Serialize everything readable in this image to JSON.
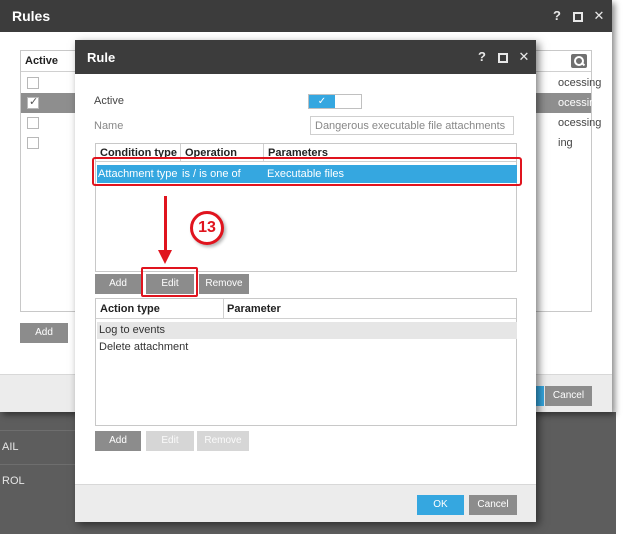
{
  "background": {
    "rows": [
      "AIL",
      "ROL"
    ]
  },
  "outer_window": {
    "title": "Rules",
    "titlebar_icons": {
      "help": "?",
      "maximize": "□",
      "close": "✕"
    },
    "grid": {
      "header_active": "Active",
      "rows": [
        {
          "checked": false,
          "selected": false,
          "text": "ocessing"
        },
        {
          "checked": true,
          "selected": true,
          "text": "ocessing"
        },
        {
          "checked": false,
          "selected": false,
          "text": "ocessing"
        },
        {
          "checked": false,
          "selected": false,
          "text": "ing"
        }
      ]
    },
    "add_label": "Add",
    "cancel_label": "Cancel"
  },
  "rule_dialog": {
    "title": "Rule",
    "titlebar_icons": {
      "help": "?",
      "maximize": "□",
      "close": "✕"
    },
    "active_label": "Active",
    "active_on": true,
    "toggle_check": "✓",
    "name_label": "Name",
    "name_value": "Dangerous executable file attachments",
    "conditions": {
      "headers": [
        "Condition type",
        "Operation",
        "Parameters"
      ],
      "rows": [
        {
          "type": "Attachment type",
          "operation": "is / is one of",
          "parameters": "Executable files"
        }
      ],
      "buttons": {
        "add": "Add",
        "edit": "Edit",
        "remove": "Remove"
      }
    },
    "step_badge": "13",
    "actions": {
      "headers": [
        "Action type",
        "Parameter"
      ],
      "rows": [
        {
          "type": "Log to events"
        },
        {
          "type": "Delete attachment"
        }
      ],
      "buttons": {
        "add": "Add",
        "edit": "Edit",
        "remove": "Remove"
      }
    },
    "ok_label": "OK",
    "cancel_label": "Cancel"
  },
  "colors": {
    "accent": "#35a7e0",
    "titlebar": "#3c3c3c",
    "highlight": "#e0141e"
  }
}
